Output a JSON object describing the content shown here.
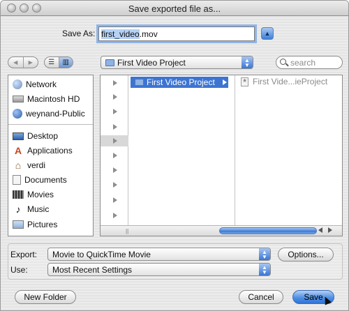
{
  "window": {
    "title": "Save exported file as..."
  },
  "save_as": {
    "label": "Save As:",
    "filename_selected": "first_video",
    "filename_ext": ".mov"
  },
  "location": {
    "popup_value": "First Video Project"
  },
  "search": {
    "placeholder": "search"
  },
  "sidebar": {
    "devices": [
      {
        "label": "Network",
        "icon": "globe-icon"
      },
      {
        "label": "Macintosh HD",
        "icon": "hard-drive-icon"
      },
      {
        "label": "weynand-Public",
        "icon": "network-volume-icon"
      }
    ],
    "places": [
      {
        "label": "Desktop",
        "icon": "desktop-icon"
      },
      {
        "label": "Applications",
        "icon": "applications-icon"
      },
      {
        "label": "verdi",
        "icon": "home-icon"
      },
      {
        "label": "Documents",
        "icon": "documents-icon"
      },
      {
        "label": "Movies",
        "icon": "movies-icon"
      },
      {
        "label": "Music",
        "icon": "music-icon"
      },
      {
        "label": "Pictures",
        "icon": "pictures-icon"
      }
    ]
  },
  "browser": {
    "selected_folder": "First Video Project",
    "child_item": "First Vide...ieProject"
  },
  "export": {
    "export_label": "Export:",
    "export_value": "Movie to QuickTime Movie",
    "options_button": "Options...",
    "use_label": "Use:",
    "use_value": "Most Recent Settings"
  },
  "buttons": {
    "new_folder": "New Folder",
    "cancel": "Cancel",
    "save": "Save"
  },
  "colors": {
    "accent": "#3d74d2",
    "selection": "#b5d1f5"
  }
}
